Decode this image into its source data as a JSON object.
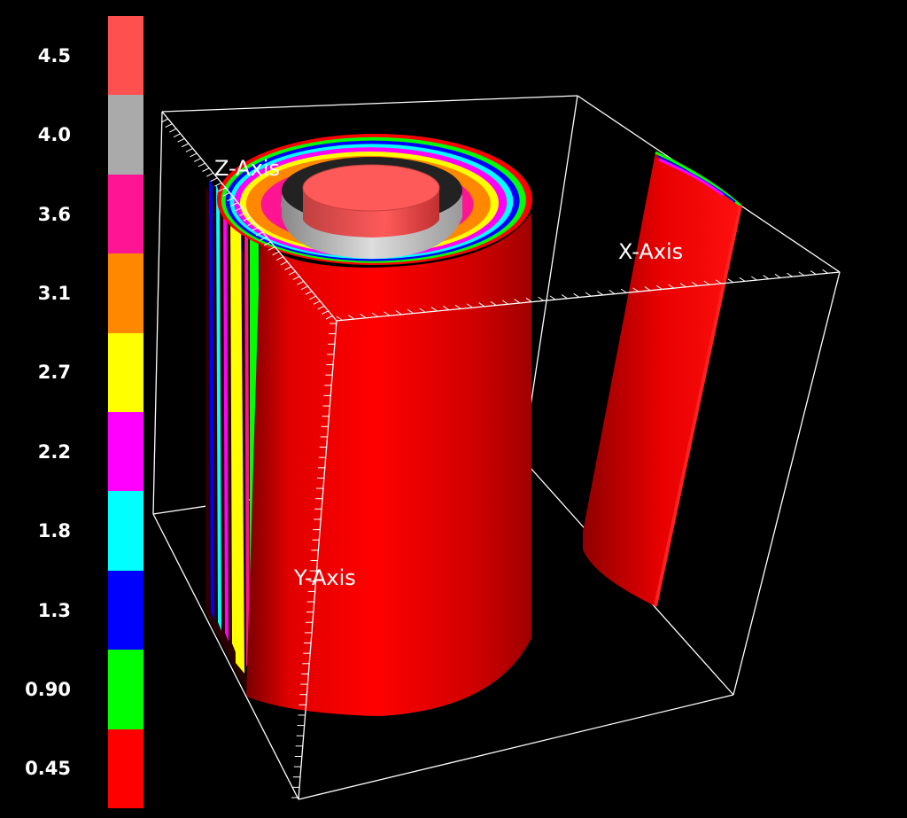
{
  "colorbar": {
    "labels": [
      "4.5",
      "4.0",
      "3.6",
      "3.1",
      "2.7",
      "2.2",
      "1.8",
      "1.3",
      "0.90",
      "0.45"
    ],
    "colors": [
      "#ff5050",
      "#aaaaaa",
      "#ff1493",
      "#ff8800",
      "#ffff00",
      "#ff00ff",
      "#00ffff",
      "#0000ff",
      "#00ff00",
      "#ff0000"
    ]
  },
  "axes": {
    "x_label": "X-Axis",
    "y_label": "Y-Axis",
    "z_label": "Z-Axis"
  },
  "scene": {
    "background": "#000000",
    "box_color": "#ffffff",
    "cylinder_color": "#ff0000",
    "ring_colors": [
      "#00ff00",
      "#0000ff",
      "#00ffff",
      "#ff00ff",
      "#ffff00",
      "#ff8800",
      "#ff1493",
      "#aaaaaa",
      "#ff5050"
    ]
  }
}
